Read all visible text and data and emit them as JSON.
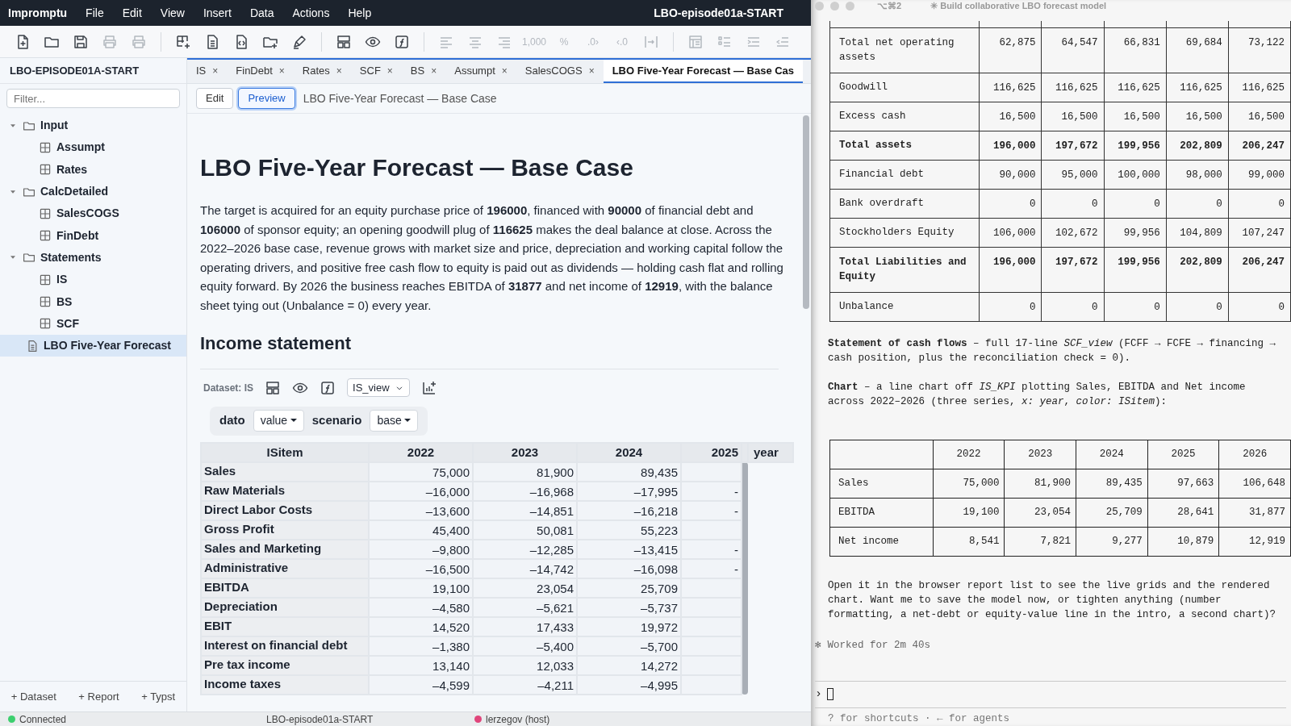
{
  "menubar": {
    "app": "Impromptu",
    "menus": [
      "File",
      "Edit",
      "View",
      "Insert",
      "Data",
      "Actions",
      "Help"
    ],
    "title": "LBO-episode01a-START"
  },
  "toolbar": [
    {
      "buttons": [
        {
          "disabled": false
        },
        {
          "disabled": false
        },
        {
          "disabled": false
        },
        {
          "disabled": true
        },
        {
          "disabled": true
        }
      ]
    },
    {
      "buttons": [
        {
          "disabled": false
        },
        {
          "disabled": false
        },
        {
          "disabled": false
        },
        {
          "disabled": false
        },
        {
          "disabled": false
        }
      ]
    },
    {
      "buttons": [
        {
          "disabled": false
        },
        {
          "disabled": false
        },
        {
          "disabled": false
        }
      ]
    },
    {
      "buttons": [
        {
          "disabled": true
        },
        {
          "disabled": true
        },
        {
          "disabled": true
        },
        {
          "label": "1,000",
          "disabled": true
        },
        {
          "label": "%",
          "disabled": true
        },
        {
          "label": ".0›",
          "disabled": true
        },
        {
          "label": "‹.0",
          "disabled": true
        },
        {
          "disabled": true
        }
      ]
    },
    {
      "buttons": [
        {
          "disabled": true
        },
        {
          "disabled": true
        },
        {
          "disabled": true
        },
        {
          "disabled": true
        }
      ]
    }
  ],
  "sidebar": {
    "title": "LBO-EPISODE01A-START",
    "filter_placeholder": "Filter...",
    "tree": [
      {
        "label": "Input",
        "kind": "folder",
        "expanded": true,
        "selected": false,
        "children": [
          {
            "label": "Assumpt",
            "kind": "dataset",
            "selected": false
          },
          {
            "label": "Rates",
            "kind": "dataset",
            "selected": false
          }
        ]
      },
      {
        "label": "CalcDetailed",
        "kind": "folder",
        "expanded": true,
        "selected": false,
        "children": [
          {
            "label": "SalesCOGS",
            "kind": "dataset",
            "selected": false
          },
          {
            "label": "FinDebt",
            "kind": "dataset",
            "selected": false
          }
        ]
      },
      {
        "label": "Statements",
        "kind": "folder",
        "expanded": true,
        "selected": false,
        "children": [
          {
            "label": "IS",
            "kind": "dataset",
            "selected": false
          },
          {
            "label": "BS",
            "kind": "dataset",
            "selected": false
          },
          {
            "label": "SCF",
            "kind": "dataset",
            "selected": false
          }
        ]
      },
      {
        "label": "LBO Five-Year Forecast",
        "kind": "report",
        "selected": true
      }
    ],
    "actions": [
      "+ Dataset",
      "+ Report",
      "+ Typst"
    ]
  },
  "tabs": [
    {
      "label": "IS",
      "close": "×",
      "selected": false
    },
    {
      "label": "FinDebt",
      "close": "×",
      "selected": false
    },
    {
      "label": "Rates",
      "close": "×",
      "selected": false
    },
    {
      "label": "SCF",
      "close": "×",
      "selected": false
    },
    {
      "label": "BS",
      "close": "×",
      "selected": false
    },
    {
      "label": "Assumpt",
      "close": "×",
      "selected": false
    },
    {
      "label": "SalesCOGS",
      "close": "×",
      "selected": false
    },
    {
      "label": "LBO Five-Year Forecast — Base Cas",
      "selected": true
    }
  ],
  "mode_buttons": [
    {
      "label": "Edit",
      "selected": false
    },
    {
      "label": "Preview",
      "selected": true
    }
  ],
  "doc_title": "LBO Five-Year Forecast — Base Case",
  "report": {
    "title": "LBO Five-Year Forecast — Base Case",
    "intro": "The target is acquired for an equity purchase price of **196000**, financed with **90000** of financial debt and **106000** of sponsor equity; an opening goodwill plug of **116625** makes the deal balance at close. Across the 2022–2026 base case, revenue grows with market size and price, depreciation and working capital follow the operating drivers, and positive free cash flow to equity is paid out as dividends — holding cash flat and rolling equity forward. By 2026 the business reaches EBITDA of **31877** and net income of **12919**, with the balance sheet tying out (Unbalance = 0) every year.",
    "section": "Income statement",
    "dataset_label": "Dataset: IS",
    "view": "IS_view",
    "filters": [
      {
        "name": "dato",
        "value": "value"
      },
      {
        "name": "scenario",
        "value": "base"
      }
    ],
    "table": {
      "columns": [
        "ISitem",
        "2022",
        "2023",
        "2024",
        "2025"
      ],
      "axis_label": "year",
      "rows": [
        {
          "label": "Sales",
          "values": [
            "75,000",
            "81,900",
            "89,435"
          ]
        },
        {
          "label": "Raw Materials",
          "values": [
            "–16,000",
            "–16,968",
            "–17,995"
          ],
          "value_2025": "-"
        },
        {
          "label": "Direct Labor Costs",
          "values": [
            "–13,600",
            "–14,851",
            "–16,218"
          ],
          "value_2025": "-"
        },
        {
          "label": "Gross Profit",
          "values": [
            "45,400",
            "50,081",
            "55,223"
          ]
        },
        {
          "label": "Sales and Marketing",
          "values": [
            "–9,800",
            "–12,285",
            "–13,415"
          ],
          "value_2025": "-"
        },
        {
          "label": "Administrative",
          "values": [
            "–16,500",
            "–14,742",
            "–16,098"
          ],
          "value_2025": "-"
        },
        {
          "label": "EBITDA",
          "values": [
            "19,100",
            "23,054",
            "25,709"
          ]
        },
        {
          "label": "Depreciation",
          "values": [
            "–4,580",
            "–5,621",
            "–5,737"
          ]
        },
        {
          "label": "EBIT",
          "values": [
            "14,520",
            "17,433",
            "19,972"
          ]
        },
        {
          "label": "Interest on financial debt",
          "values": [
            "–1,380",
            "–5,400",
            "–5,700"
          ]
        },
        {
          "label": "Pre tax income",
          "values": [
            "13,140",
            "12,033",
            "14,272"
          ]
        },
        {
          "label": "Income taxes",
          "values": [
            "–4,599",
            "–4,211",
            "–4,995"
          ]
        }
      ]
    }
  },
  "status": {
    "connection": "Connected",
    "connected": true,
    "file": "LBO-episode01a-START",
    "user": "lerzegov (host)"
  },
  "terminal": {
    "shortcut": "⌥⌘2",
    "title": "✳ Build collaborative LBO forecast model",
    "balance_rows": [
      {
        "label": "Total net operating assets",
        "values": [
          "62,875",
          "64,547",
          "66,831",
          "69,684",
          "73,122"
        ],
        "bold": false
      },
      {
        "label": "Goodwill",
        "values": [
          "116,625",
          "116,625",
          "116,625",
          "116,625",
          "116,625"
        ],
        "bold": false
      },
      {
        "label": "Excess cash",
        "values": [
          "16,500",
          "16,500",
          "16,500",
          "16,500",
          "16,500"
        ],
        "bold": false
      },
      {
        "label": "Total assets",
        "values": [
          "196,000",
          "197,672",
          "199,956",
          "202,809",
          "206,247"
        ],
        "bold": true
      },
      {
        "label": "Financial debt",
        "values": [
          "90,000",
          "95,000",
          "100,000",
          "98,000",
          "99,000"
        ],
        "bold": false
      },
      {
        "label": "Bank overdraft",
        "values": [
          "0",
          "0",
          "0",
          "0",
          "0"
        ],
        "bold": false
      },
      {
        "label": "Stockholders Equity",
        "values": [
          "106,000",
          "102,672",
          "99,956",
          "104,809",
          "107,247"
        ],
        "bold": false
      },
      {
        "label": "Total Liabilities and Equity",
        "values": [
          "196,000",
          "197,672",
          "199,956",
          "202,809",
          "206,247"
        ],
        "bold": true
      },
      {
        "label": "Unbalance",
        "values": [
          "0",
          "0",
          "0",
          "0",
          "0"
        ],
        "bold": false
      }
    ],
    "notes": [
      "**Statement of cash flows** – full 17-line *SCF_view* (FCFF → FCFE → financing → cash position, plus the reconciliation check = 0).",
      "**Chart** – a line chart off *IS_KPI* plotting Sales, EBITDA and Net income across 2022–2026 (three series, *x: year*, *color: ISitem*):"
    ],
    "kpi_table": {
      "columns": [
        "2022",
        "2023",
        "2024",
        "2025",
        "2026"
      ],
      "rows": [
        {
          "label": "Sales",
          "values": [
            "75,000",
            "81,900",
            "89,435",
            "97,663",
            "106,648"
          ]
        },
        {
          "label": "EBITDA",
          "values": [
            "19,100",
            "23,054",
            "25,709",
            "28,641",
            "31,877"
          ]
        },
        {
          "label": "Net income",
          "values": [
            "8,541",
            "7,821",
            "9,277",
            "10,879",
            "12,919"
          ]
        }
      ]
    },
    "closing": "Open it in the browser report list to see the live grids and the rendered chart. Want me to save the model now, or tighten anything (number formatting, a net-debt or equity-value line in the intro, a second chart)?",
    "worked": {
      "mark": "✻",
      "text": "Worked for 2m 40s"
    },
    "prompt": "›",
    "hint": "? for shortcuts · ← for agents"
  }
}
